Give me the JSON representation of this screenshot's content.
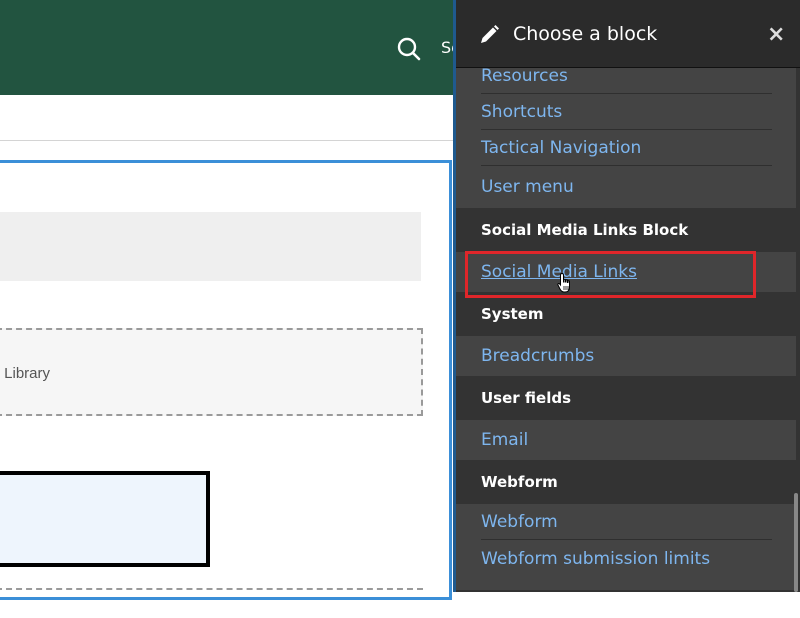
{
  "site": {
    "search_label": "Search",
    "dashed_text": "Library"
  },
  "tray": {
    "title": "Choose a block",
    "close_label": "×",
    "sections": [
      {
        "title": null,
        "links": [
          "Resources",
          "Shortcuts",
          "Tactical Navigation",
          "User menu"
        ]
      },
      {
        "title": "Social Media Links Block",
        "links": [
          "Social Media Links"
        ]
      },
      {
        "title": "System",
        "links": [
          "Breadcrumbs"
        ]
      },
      {
        "title": "User fields",
        "links": [
          "Email"
        ]
      },
      {
        "title": "Webform",
        "links": [
          "Webform",
          "Webform submission limits"
        ]
      }
    ],
    "hovered_link": "Social Media Links",
    "highlight_color": "#e0262a",
    "link_color": "#7eb6ef"
  }
}
